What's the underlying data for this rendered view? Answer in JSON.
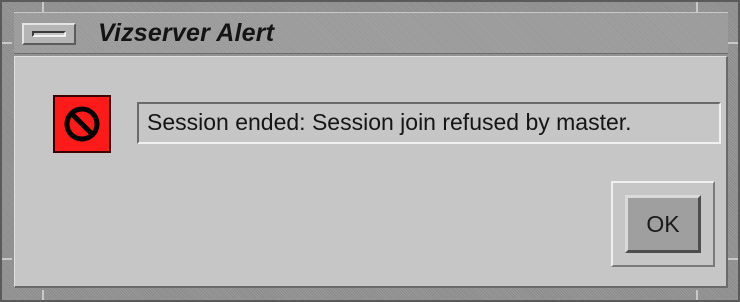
{
  "window": {
    "title": "Vizserver Alert"
  },
  "alert": {
    "icon": "no-entry-icon",
    "icon_color": "#ff1a1a",
    "message": "Session ended: Session join refused by master."
  },
  "buttons": {
    "ok_label": "OK"
  }
}
